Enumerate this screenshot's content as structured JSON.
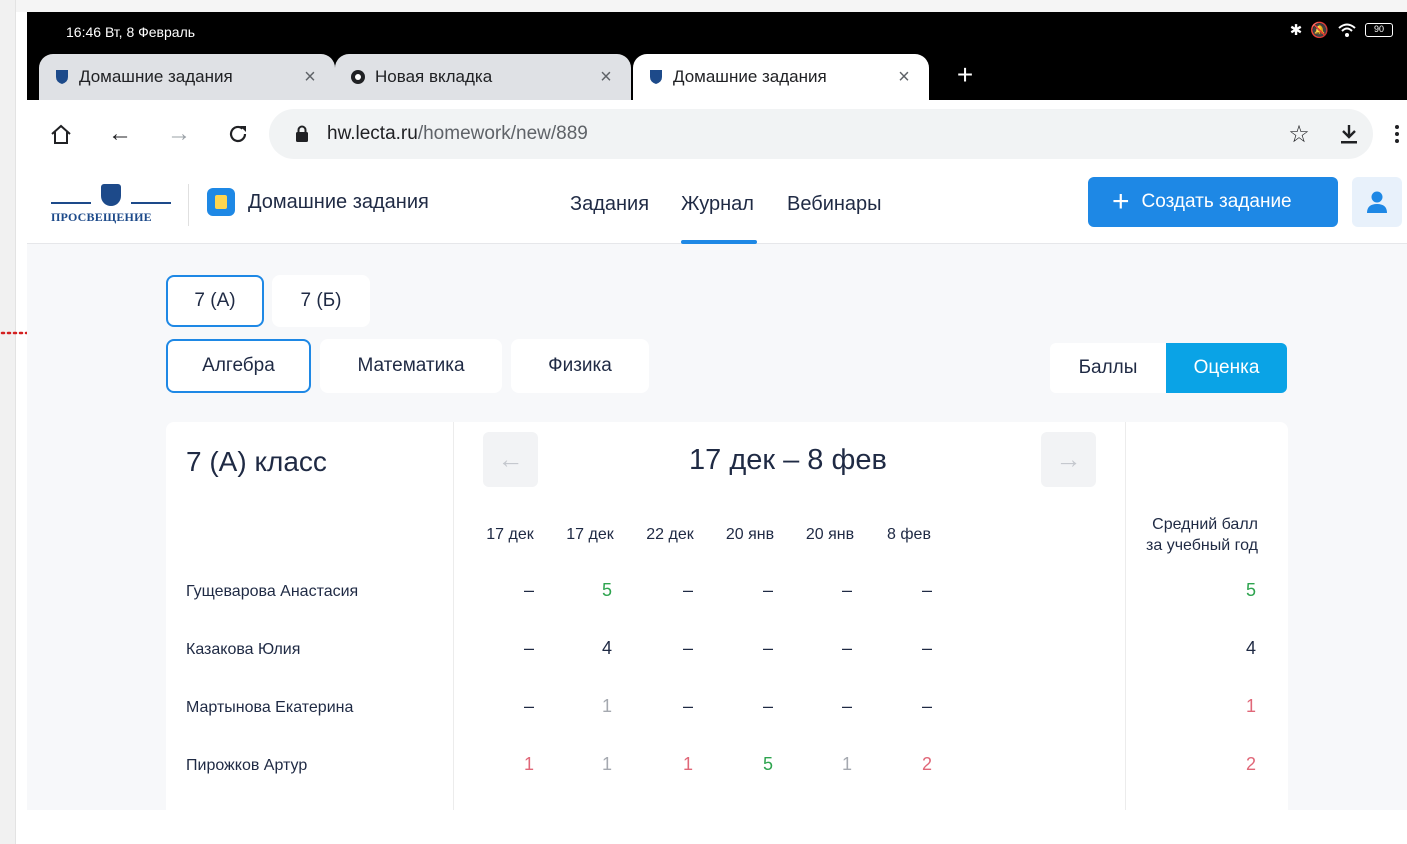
{
  "status": {
    "time": "16:46",
    "date": "Вт, 8 Февраль",
    "battery": "90"
  },
  "tabs": [
    {
      "title": "Домашние задания",
      "active": false
    },
    {
      "title": "Новая вкладка",
      "active": false
    },
    {
      "title": "Домашние задания",
      "active": true
    }
  ],
  "omnibox": {
    "host": "hw.lecta.ru",
    "path": "/homework/new/889"
  },
  "header": {
    "brand": "ПРОСВЕЩЕНИЕ",
    "app_title": "Домашние задания",
    "nav": [
      "Задания",
      "Журнал",
      "Вебинары"
    ],
    "active_nav": "Журнал",
    "create_label": "Создать задание"
  },
  "classes": [
    "7 (А)",
    "7 (Б)"
  ],
  "selected_class": "7 (А)",
  "subjects": [
    "Алгебра",
    "Математика",
    "Физика"
  ],
  "selected_subject": "Алгебра",
  "view_toggle": {
    "options": [
      "Баллы",
      "Оценка"
    ],
    "selected": "Оценка"
  },
  "journal": {
    "class_title": "7 (А) класс",
    "range": "17 дек – 8 фев",
    "dates": [
      "17 дек",
      "17 дек",
      "22 дек",
      "20 янв",
      "20 янв",
      "8 фев"
    ],
    "avg_header_line1": "Средний балл",
    "avg_header_line2": "за учебный год",
    "students": [
      {
        "name": "Гущеварова Анастасия",
        "grades": [
          "–",
          "5",
          "–",
          "–",
          "–",
          "–"
        ],
        "avg": "5"
      },
      {
        "name": "Казакова Юлия",
        "grades": [
          "–",
          "4",
          "–",
          "–",
          "–",
          "–"
        ],
        "avg": "4"
      },
      {
        "name": "Мартынова Екатерина",
        "grades": [
          "–",
          "1",
          "–",
          "–",
          "–",
          "–"
        ],
        "avg": "1"
      },
      {
        "name": "Пирожков Артур",
        "grades": [
          "1",
          "1",
          "1",
          "5",
          "1",
          "2"
        ],
        "avg": "2"
      }
    ]
  },
  "colors": {
    "accent": "#1e88e5",
    "toggle_active": "#0aa3e6",
    "grade_good": "#2ea44f",
    "grade_bad": "#e06778",
    "grade_muted": "#a5a9b0",
    "annotation": "#d32020"
  }
}
